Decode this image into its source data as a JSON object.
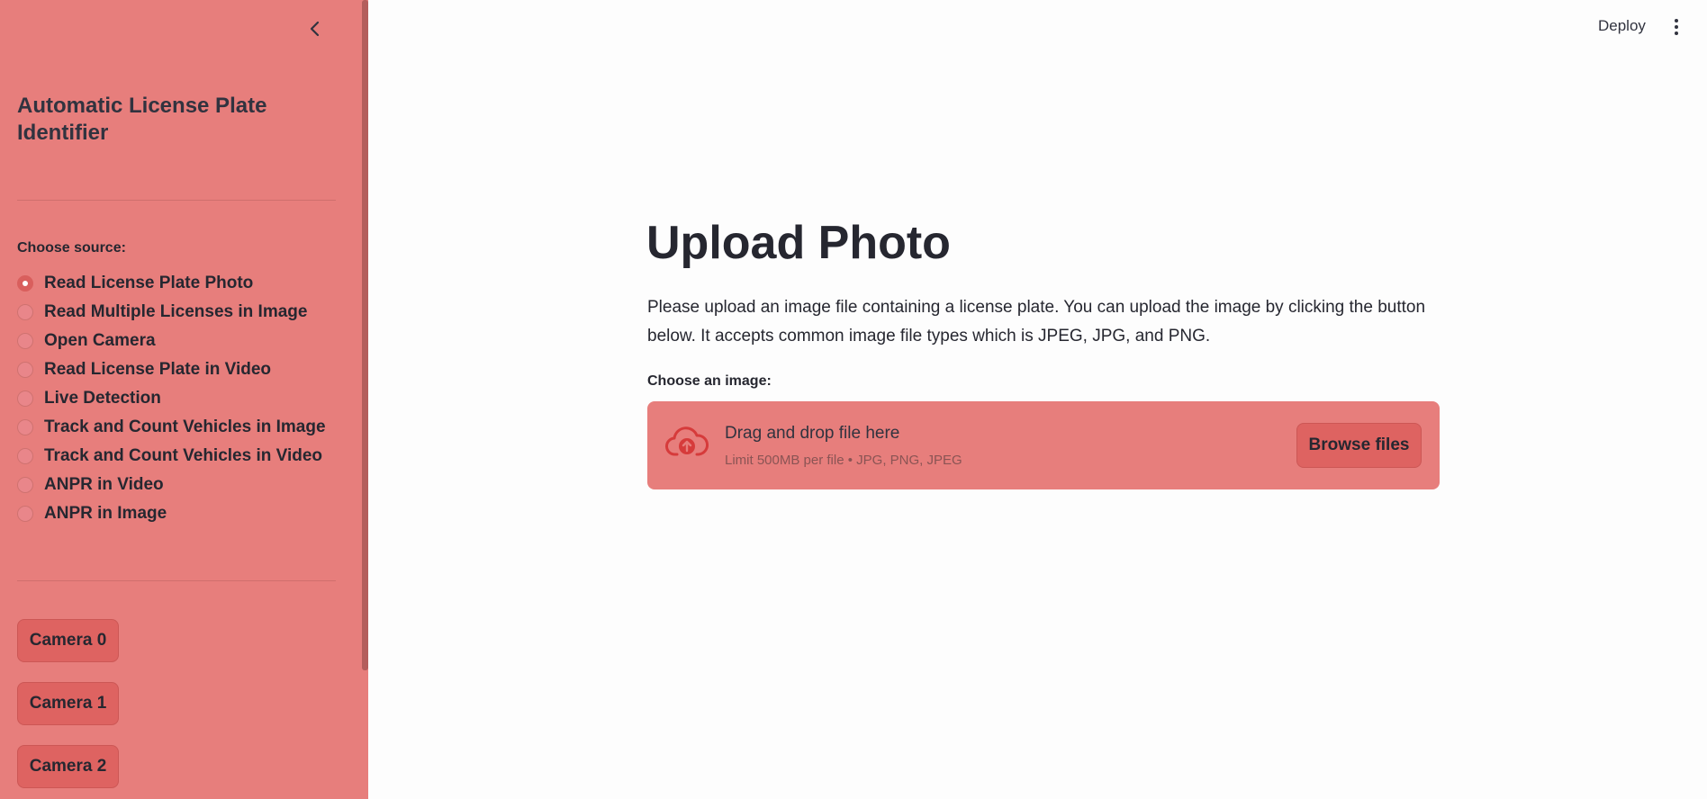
{
  "header": {
    "deploy_label": "Deploy"
  },
  "sidebar": {
    "app_title": "Automatic License Plate Identifier",
    "radio_group_label": "Choose source:",
    "selected_index": 0,
    "options": [
      "Read License Plate Photo",
      "Read Multiple Licenses in Image",
      "Open Camera",
      "Read License Plate in Video",
      "Live Detection",
      "Track and Count Vehicles in Image",
      "Track and Count Vehicles in Video",
      "ANPR in Video",
      "ANPR in Image"
    ],
    "camera_buttons": [
      "Camera 0",
      "Camera 1",
      "Camera 2"
    ]
  },
  "main": {
    "title": "Upload Photo",
    "description": "Please upload an image file containing a license plate. You can upload the image by clicking the button below. It accepts common image file types which is JPEG, JPG, and PNG.",
    "uploader": {
      "label": "Choose an image:",
      "drag_text": "Drag and drop file here",
      "limit_text": "Limit 500MB per file • JPG, PNG, JPEG",
      "browse_label": "Browse files"
    }
  },
  "colors": {
    "sidebar_bg": "#e77e7c",
    "button_bg": "#de6361",
    "upload_icon": "#d63b3b",
    "page_bg": "#fdfdfd"
  },
  "icons": {
    "collapse": "chevron-left-icon",
    "menu": "vertical-dots-icon",
    "upload": "cloud-upload-icon"
  }
}
